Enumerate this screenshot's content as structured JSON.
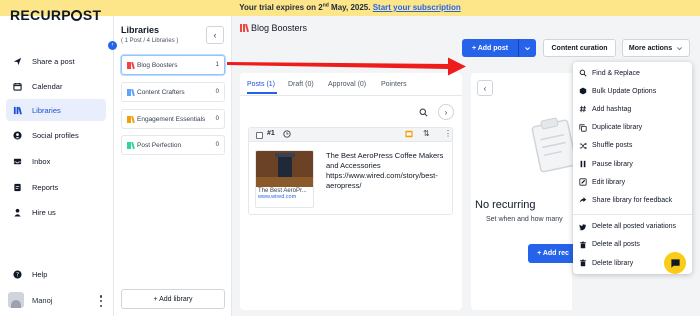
{
  "banner": {
    "prefix": "Your trial expires on 2",
    "sup": "nd",
    "suffix": " May, 2025. ",
    "link": "Start your subscription"
  },
  "brand": {
    "logo": "RECURPOST"
  },
  "sidebar": {
    "items": [
      {
        "label": "Share a post",
        "icon": "send-icon"
      },
      {
        "label": "Calendar",
        "icon": "calendar-icon"
      },
      {
        "label": "Libraries",
        "icon": "libraries-icon",
        "active": true
      },
      {
        "label": "Social profiles",
        "icon": "profile-icon"
      },
      {
        "label": "Inbox",
        "icon": "inbox-icon"
      },
      {
        "label": "Reports",
        "icon": "reports-icon"
      },
      {
        "label": "Hire us",
        "icon": "person-icon"
      }
    ],
    "help": "Help",
    "user": "Manoj"
  },
  "libraries": {
    "title": "Libraries",
    "subtitle": "( 1 Post / 4 Libraries )",
    "items": [
      {
        "name": "Blog Boosters",
        "count": "1",
        "color": "#ef4444"
      },
      {
        "name": "Content Crafters",
        "count": "0",
        "color": "#60a5fa"
      },
      {
        "name": "Engagement Essentials",
        "count": "0",
        "color": "#f59e0b"
      },
      {
        "name": "Post Perfection",
        "count": "0",
        "color": "#34d399"
      }
    ],
    "add_label": "+ Add library"
  },
  "main": {
    "title": "Blog Boosters",
    "add_post": "+ Add post",
    "content_curation": "Content curation",
    "more_actions": "More actions",
    "tabs": [
      "Posts (1)",
      "Draft (0)",
      "Approval (0)",
      "Pointers"
    ],
    "post": {
      "number": "#1",
      "thumb_caption": "The Best AeroPr...",
      "thumb_url": "www.wired.com",
      "text": "The Best AeroPress Coffee Makers and Accessories https://www.wired.com/story/best-aeropress/"
    },
    "empty": {
      "title": "No recurring",
      "subtitle": "Set when and how many",
      "button": "+ Add rec"
    }
  },
  "dropdown": {
    "groups": [
      [
        {
          "label": "Find & Replace",
          "icon": "search-icon"
        },
        {
          "label": "Bulk Update Options",
          "icon": "cube-icon"
        },
        {
          "label": "Add hashtag",
          "icon": "hashtag-icon"
        },
        {
          "label": "Duplicate library",
          "icon": "copy-icon"
        },
        {
          "label": "Shuffle posts",
          "icon": "shuffle-icon"
        },
        {
          "label": "Pause library",
          "icon": "pause-icon"
        },
        {
          "label": "Edit library",
          "icon": "edit-icon"
        },
        {
          "label": "Share library for feedback",
          "icon": "share-icon"
        }
      ],
      [
        {
          "label": "Delete all posted variations",
          "icon": "twitter-icon"
        },
        {
          "label": "Delete all posts",
          "icon": "trash-icon"
        },
        {
          "label": "Delete library",
          "icon": "trash-icon"
        }
      ]
    ]
  },
  "colors": {
    "accent": "#2563eb",
    "banner": "#fde68a",
    "annotation_arrow": "#ef1c1c",
    "chat": "#facc15"
  }
}
